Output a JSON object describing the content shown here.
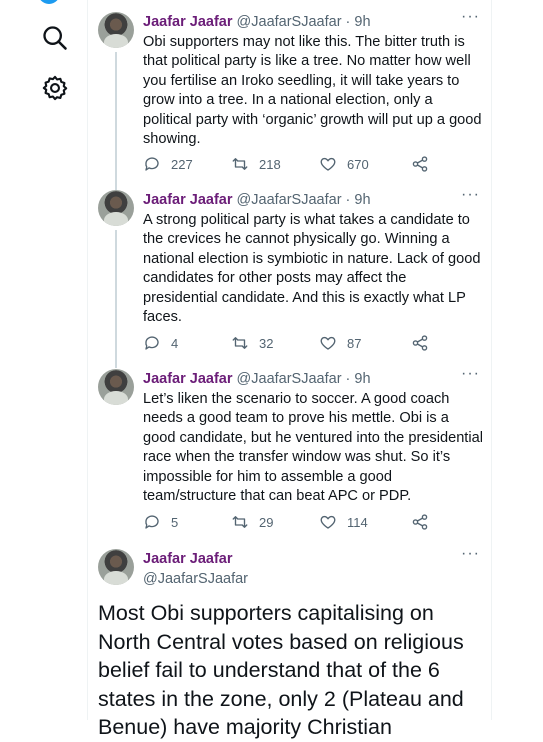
{
  "nav": {
    "icons": [
      "twitter-logo",
      "search-icon",
      "gear-icon"
    ]
  },
  "tweets": [
    {
      "name": "Jaafar Jaafar",
      "handle": "@JaafarSJaafar",
      "time": "9h",
      "text": "Obi supporters may not like this. The bitter truth is that political party is like a tree. No matter how well you fertilise an Iroko seedling, it will take years to grow into a tree. In a national election, only a political party with ‘organic’ growth will put up a good showing.",
      "replies": "227",
      "retweets": "218",
      "likes": "670"
    },
    {
      "name": "Jaafar Jaafar",
      "handle": "@JaafarSJaafar",
      "time": "9h",
      "text": "A strong political party is what takes a candidate to the crevices he cannot physically go. Winning a national election is symbiotic in nature. Lack of good candidates for other posts may affect the presidential candidate. And this is exactly what LP faces.",
      "replies": "4",
      "retweets": "32",
      "likes": "87"
    },
    {
      "name": "Jaafar Jaafar",
      "handle": "@JaafarSJaafar",
      "time": "9h",
      "text": "Let’s liken the scenario to soccer. A good coach needs a good team to prove his mettle. Obi is a good candidate, but he ventured into the presidential race when the transfer window was shut. So it’s impossible for him to assemble a good team/structure that can beat APC or PDP.",
      "replies": "5",
      "retweets": "29",
      "likes": "114"
    }
  ],
  "focused": {
    "name": "Jaafar Jaafar",
    "handle": "@JaafarSJaafar",
    "text": "Most Obi supporters capitalising on North Central votes based on religious belief fail to understand that of the 6 states in the zone, only 2 (Plateau and Benue) have majority Christian"
  },
  "colors": {
    "name": "#6b1d78",
    "muted": "#536471",
    "accent": "#1d9bf0"
  }
}
